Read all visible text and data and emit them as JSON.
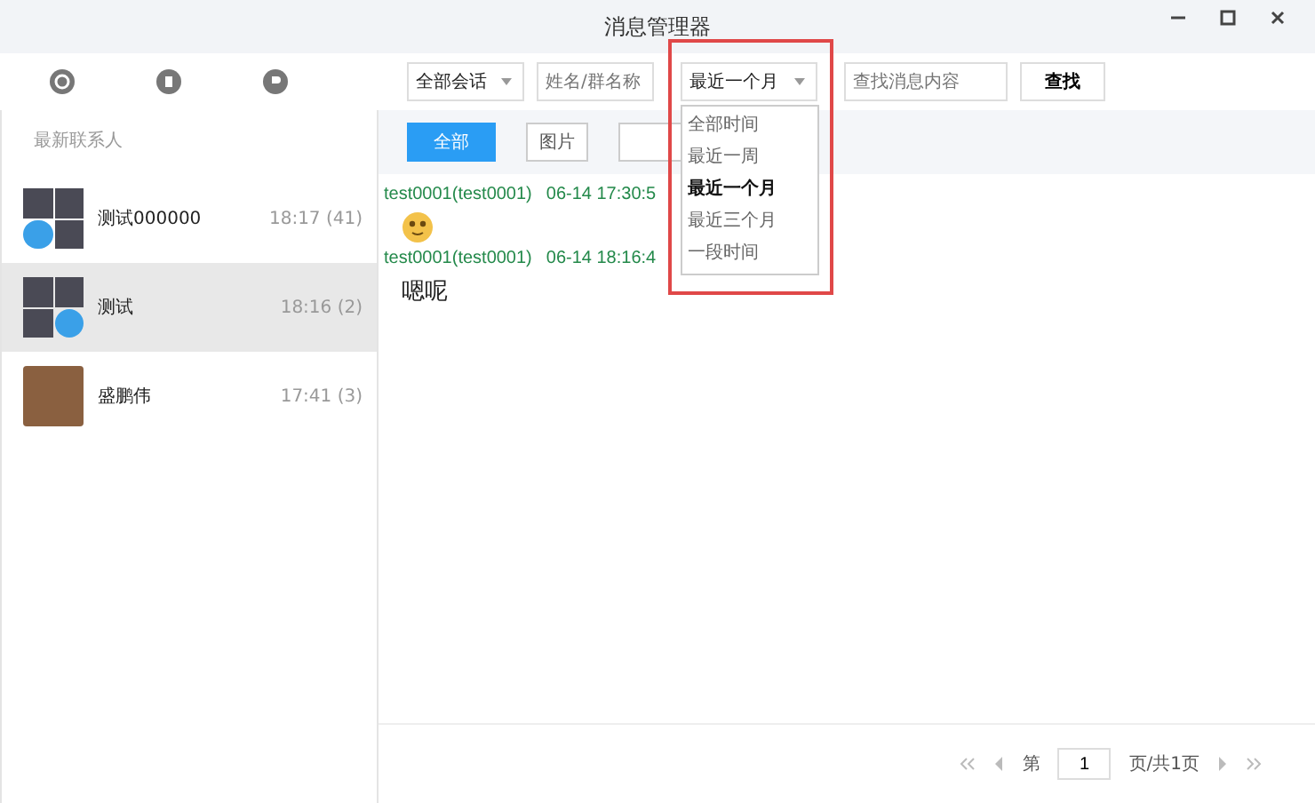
{
  "window": {
    "title": "消息管理器"
  },
  "toolbar": {
    "session_filter": "全部会话",
    "name_field": {
      "placeholder": "姓名/群名称"
    },
    "time_filter": "最近一个月",
    "search_field": {
      "placeholder": "查找消息内容"
    },
    "search_button": "查找"
  },
  "time_menu": [
    {
      "label": "全部时间",
      "selected": false
    },
    {
      "label": "最近一周",
      "selected": false
    },
    {
      "label": "最近一个月",
      "selected": true
    },
    {
      "label": "最近三个月",
      "selected": false
    },
    {
      "label": "一段时间",
      "selected": false
    }
  ],
  "sidebar": {
    "header": "最新联系人",
    "contacts": [
      {
        "name": "测试000000",
        "time": "18:17 (41)",
        "kind": "group",
        "selected": false
      },
      {
        "name": "测试",
        "time": "18:16 (2)",
        "kind": "group",
        "selected": true
      },
      {
        "name": "盛鹏伟",
        "time": "17:41 (3)",
        "kind": "person",
        "selected": false
      }
    ]
  },
  "type_tabs": [
    {
      "label": "全部",
      "selected": true
    },
    {
      "label": "图片",
      "selected": false
    },
    {
      "selected": false
    }
  ],
  "messages": [
    {
      "sender": "test0001(test0001)",
      "time": "06-14 17:30:5",
      "kind": "emoji"
    },
    {
      "sender": "test0001(test0001)",
      "time": "06-14 18:16:4",
      "kind": "text",
      "text": "嗯呢"
    }
  ],
  "pagination": {
    "prefix": "第",
    "page": "1",
    "suffix": "页/共1页"
  }
}
